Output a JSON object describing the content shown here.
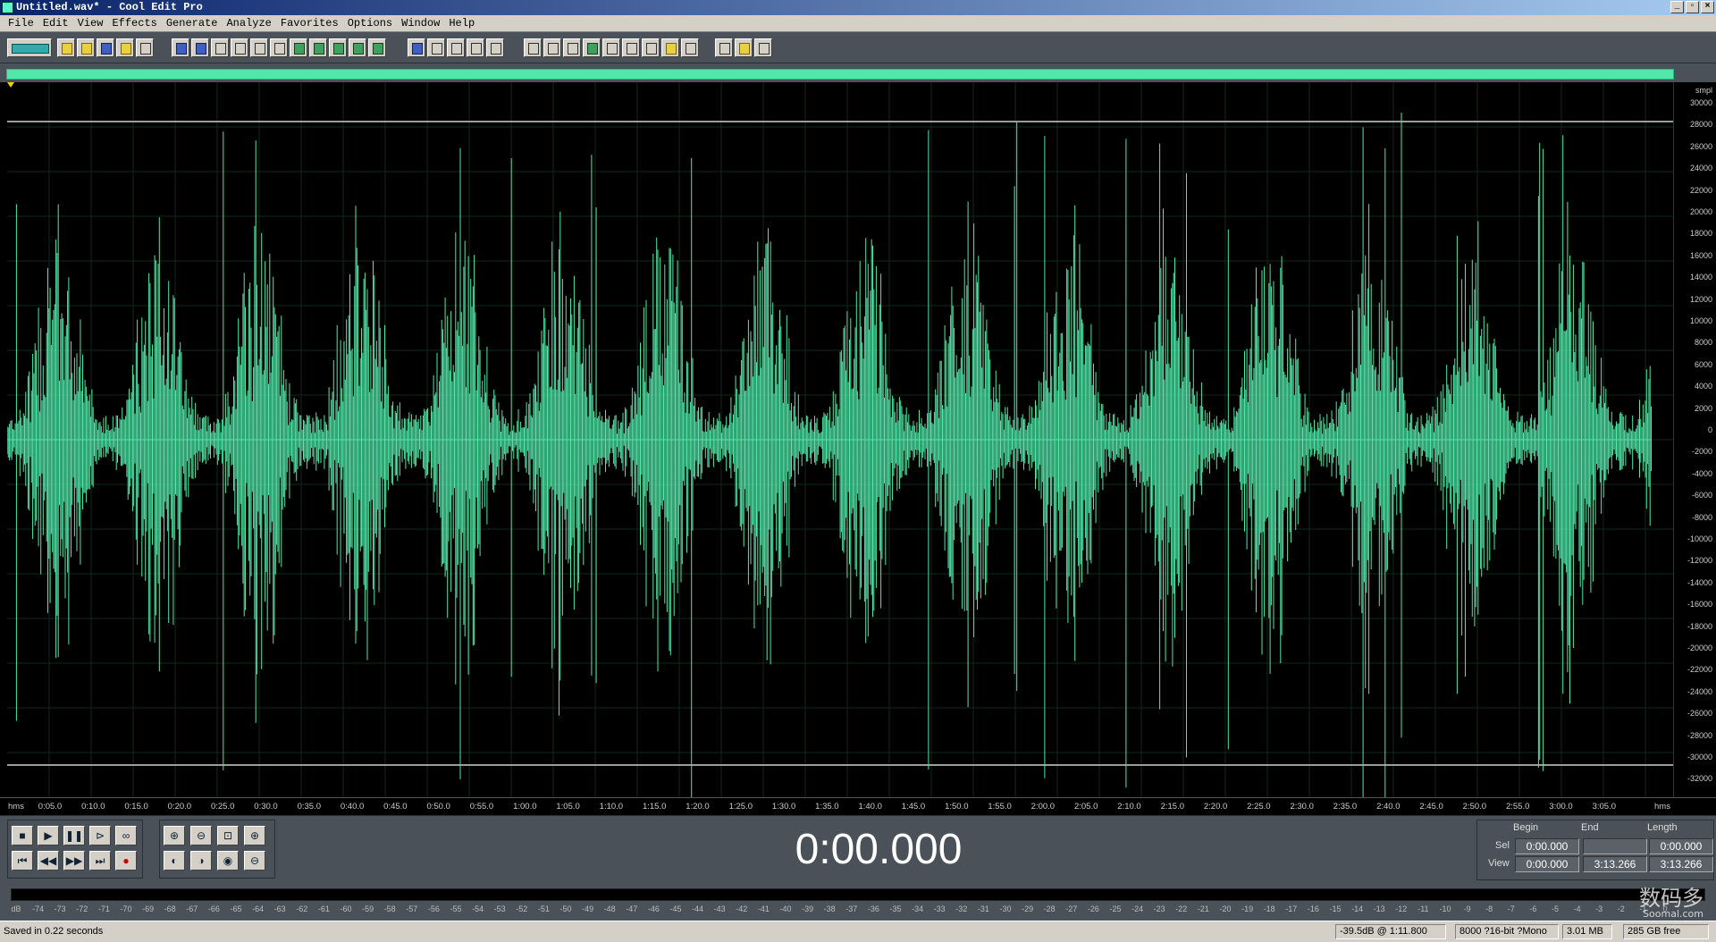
{
  "window": {
    "title": "Untitled.wav* - Cool Edit Pro"
  },
  "menu": [
    "File",
    "Edit",
    "View",
    "Effects",
    "Generate",
    "Analyze",
    "Favorites",
    "Options",
    "Window",
    "Help"
  ],
  "wave_color": "#52e6a8",
  "amp_ruler": {
    "unit": "smpl",
    "labels": [
      "30000",
      "28000",
      "26000",
      "24000",
      "22000",
      "20000",
      "18000",
      "16000",
      "14000",
      "12000",
      "10000",
      "8000",
      "6000",
      "4000",
      "2000",
      "0",
      "-2000",
      "-4000",
      "-6000",
      "-8000",
      "-10000",
      "-12000",
      "-14000",
      "-16000",
      "-18000",
      "-20000",
      "-22000",
      "-24000",
      "-26000",
      "-28000",
      "-30000",
      "-32000"
    ]
  },
  "time_ruler": {
    "unit_left": "hms",
    "unit_right": "hms",
    "labels": [
      "0:05.0",
      "0:10.0",
      "0:15.0",
      "0:20.0",
      "0:25.0",
      "0:30.0",
      "0:35.0",
      "0:40.0",
      "0:45.0",
      "0:50.0",
      "0:55.0",
      "1:00.0",
      "1:05.0",
      "1:10.0",
      "1:15.0",
      "1:20.0",
      "1:25.0",
      "1:30.0",
      "1:35.0",
      "1:40.0",
      "1:45.0",
      "1:50.0",
      "1:55.0",
      "2:00.0",
      "2:05.0",
      "2:10.0",
      "2:15.0",
      "2:20.0",
      "2:25.0",
      "2:30.0",
      "2:35.0",
      "2:40.0",
      "2:45.0",
      "2:50.0",
      "2:55.0",
      "3:00.0",
      "3:05.0"
    ]
  },
  "transport": {
    "row1": [
      {
        "name": "stop-button",
        "glyph": "■"
      },
      {
        "name": "play-button",
        "glyph": "▶"
      },
      {
        "name": "pause-button",
        "glyph": "❚❚"
      },
      {
        "name": "play-to-end-button",
        "glyph": "⊳"
      },
      {
        "name": "loop-button",
        "glyph": "∞"
      }
    ],
    "row2": [
      {
        "name": "go-to-start-button",
        "glyph": "⏮"
      },
      {
        "name": "rewind-button",
        "glyph": "◀◀"
      },
      {
        "name": "fast-forward-button",
        "glyph": "▶▶"
      },
      {
        "name": "go-to-end-button",
        "glyph": "⏭"
      },
      {
        "name": "record-button",
        "glyph": "●"
      }
    ],
    "zoom1": [
      {
        "name": "zoom-in-horizontal-button",
        "glyph": "⊕"
      },
      {
        "name": "zoom-out-horizontal-button",
        "glyph": "⊖"
      },
      {
        "name": "zoom-full-button",
        "glyph": "⊡"
      },
      {
        "name": "zoom-in-vertical-button",
        "glyph": "⊕"
      }
    ],
    "zoom2": [
      {
        "name": "zoom-left-button",
        "glyph": "◐"
      },
      {
        "name": "zoom-right-button",
        "glyph": "◑"
      },
      {
        "name": "zoom-selection-button",
        "glyph": "◉"
      },
      {
        "name": "zoom-out-vertical-button",
        "glyph": "⊖"
      }
    ]
  },
  "time_display": "0:00.000",
  "selection": {
    "headers": {
      "begin": "Begin",
      "end": "End",
      "length": "Length"
    },
    "sel_label": "Sel",
    "view_label": "View",
    "sel": {
      "begin": "0:00.000",
      "end": "",
      "length": "0:00.000"
    },
    "view": {
      "begin": "0:00.000",
      "end": "3:13.266",
      "length": "3:13.266"
    }
  },
  "level_scale": [
    "dB",
    "-74",
    "-73",
    "-72",
    "-71",
    "-70",
    "-69",
    "-68",
    "-67",
    "-66",
    "-65",
    "-64",
    "-63",
    "-62",
    "-61",
    "-60",
    "-59",
    "-58",
    "-57",
    "-56",
    "-55",
    "-54",
    "-53",
    "-52",
    "-51",
    "-50",
    "-49",
    "-48",
    "-47",
    "-46",
    "-45",
    "-44",
    "-43",
    "-42",
    "-41",
    "-40",
    "-39",
    "-38",
    "-37",
    "-36",
    "-35",
    "-34",
    "-33",
    "-32",
    "-31",
    "-30",
    "-29",
    "-28",
    "-27",
    "-26",
    "-25",
    "-24",
    "-23",
    "-22",
    "-21",
    "-20",
    "-19",
    "-18",
    "-17",
    "-16",
    "-15",
    "-14",
    "-13",
    "-12",
    "-11",
    "-10",
    "-9",
    "-8",
    "-7",
    "-6",
    "-5",
    "-4",
    "-3",
    "-2",
    "-1",
    "0"
  ],
  "status": {
    "message": "Saved in 0.22 seconds",
    "cursor": "-39.5dB @  1:11.800",
    "format": "8000 ?16-bit ?Mono",
    "size": "3.01 MB",
    "free": "285 GB free"
  },
  "watermark": {
    "main": "数码多",
    "sub": "Soomal.com"
  }
}
